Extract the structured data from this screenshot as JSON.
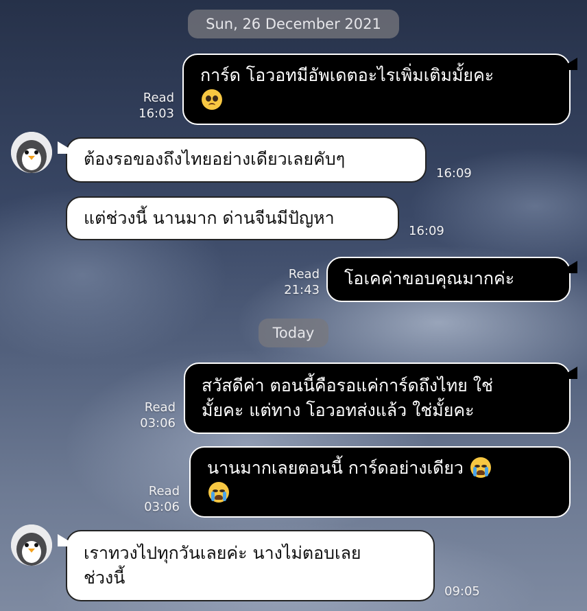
{
  "dates": {
    "first": "Sun, 26 December 2021",
    "second": "Today"
  },
  "messages": [
    {
      "side": "out",
      "text": "การ์ด โอวอทมีอัพเดตอะไรเพิ่มเติมมั้ยคะ",
      "emoji": "pleading-face-emoji",
      "read": "Read",
      "time": "16:03"
    },
    {
      "side": "in",
      "text": "ต้องรอของถึงไทยอย่างเดียวเลยคับๆ",
      "time": "16:09"
    },
    {
      "side": "in",
      "text": "แต่ช่วงนี้ นานมาก ด่านจีนมีปัญหา",
      "time": "16:09"
    },
    {
      "side": "out",
      "text": "โอเคค่าขอบคุณมากค่ะ",
      "read": "Read",
      "time": "21:43"
    },
    {
      "side": "out",
      "line1": "สวัสดีค่า ตอนนี้คือรอแค่การ์ดถึงไทย ใช่",
      "line2": "มั้ยคะ แต่ทาง โอวอทส่งแล้ว ใช่มั้ยคะ",
      "read": "Read",
      "time": "03:06"
    },
    {
      "side": "out",
      "text": "นานมากเลยตอนนี้ การ์ดอย่างเดียว",
      "emoji": "loudly-crying-face-emoji",
      "read": "Read",
      "time": "03:06"
    },
    {
      "side": "in",
      "line1": "เราทวงไปทุกวันเลยค่ะ นางไม่ตอบเลย",
      "line2": "ช่วงนี้",
      "time": "09:05"
    }
  ],
  "avatar_icon": "penguin-avatar-icon",
  "colors": {
    "outgoing_bubble": "#000000",
    "incoming_bubble": "#ffffff",
    "date_pill": "#78787d"
  }
}
